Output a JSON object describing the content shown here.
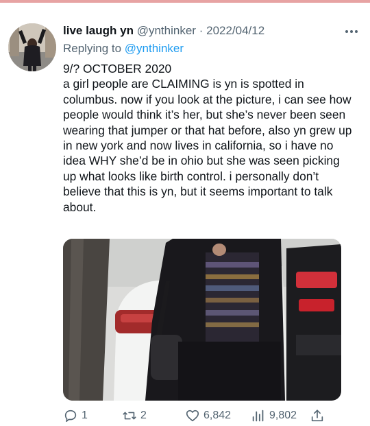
{
  "tweet": {
    "display_name": "live laugh yn",
    "handle": "@ynthinker",
    "separator": "·",
    "date": "2022/04/12",
    "replying_prefix": "Replying to",
    "replying_to": "@ynthinker",
    "text_lines": [
      "9/? OCTOBER 2020",
      "a girl people are CLAIMING is yn is spotted in columbus. now if you look at the picture, i can see how people would think it’s her, but she’s never been seen wearing that jumper or that hat before, also yn grew up in new york and now lives in california, so i have no idea WHY she’d be in ohio but she was seen picking up what looks like birth control. i personally don’t believe that this is yn, but it seems important to talk about."
    ]
  },
  "actions": {
    "reply_count": "1",
    "retweet_count": "2",
    "like_count": "6,842",
    "view_count": "9,802"
  },
  "icons": {
    "more": "more-icon",
    "reply": "reply-icon",
    "retweet": "retweet-icon",
    "like": "heart-icon",
    "views": "views-icon",
    "share": "share-icon"
  },
  "colors": {
    "text": "#0f1419",
    "secondary": "#536471",
    "link": "#1d9bf0",
    "top_rule": "#e7a3a3"
  }
}
